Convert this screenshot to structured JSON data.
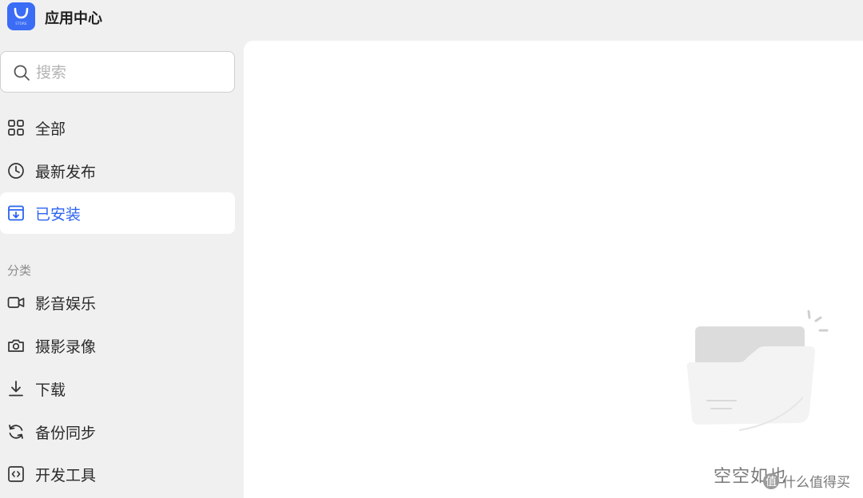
{
  "app": {
    "title": "应用中心",
    "logo_text": "STORE"
  },
  "search": {
    "placeholder": "搜索"
  },
  "nav": {
    "items": [
      {
        "label": "全部",
        "icon": "grid-icon"
      },
      {
        "label": "最新发布",
        "icon": "clock-icon"
      },
      {
        "label": "已安装",
        "icon": "installed-box-icon",
        "active": true
      }
    ]
  },
  "categories": {
    "title": "分类",
    "items": [
      {
        "label": "影音娱乐",
        "icon": "video-camera-icon"
      },
      {
        "label": "摄影录像",
        "icon": "camera-icon"
      },
      {
        "label": "下载",
        "icon": "download-icon"
      },
      {
        "label": "备份同步",
        "icon": "sync-icon"
      },
      {
        "label": "开发工具",
        "icon": "code-icon"
      }
    ]
  },
  "main": {
    "empty_text": "空空如也"
  },
  "watermark": {
    "text": "什么值得买",
    "badge": "值"
  },
  "colors": {
    "accent": "#2b63f0",
    "sidebar_bg": "#f0f0f0",
    "content_bg": "#ffffff"
  }
}
